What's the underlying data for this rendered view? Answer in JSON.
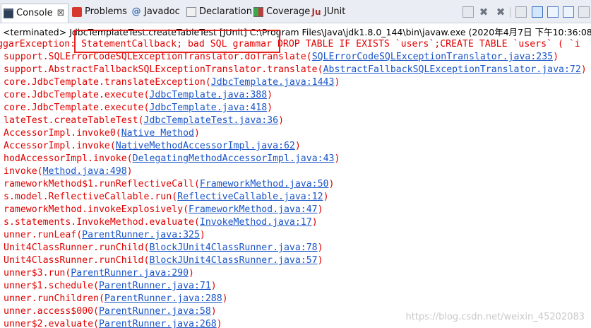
{
  "tabs": [
    {
      "label": "Console",
      "close": "⊠",
      "icon": "console-icon"
    },
    {
      "label": "Problems",
      "icon": "problems-icon"
    },
    {
      "label": "Javadoc",
      "icon": "javadoc-icon"
    },
    {
      "label": "Declaration",
      "icon": "declaration-icon"
    },
    {
      "label": "Coverage",
      "icon": "coverage-icon"
    },
    {
      "label": "JUnit",
      "icon": "junit-icon"
    }
  ],
  "status": "<terminated> JdbcTemplateTest.createTableTest [JUnit] C:\\Program Files\\Java\\jdk1.8.0_144\\bin\\javaw.exe (2020年4月7日 下午10:36:08)",
  "lines": [
    {
      "pre": "ggarException: ",
      "mid": "StatementCallback; bad SQL grammar",
      "post": "  DROP TABLE IF EXISTS `users`;CREATE TABLE `users` (  `i"
    },
    {
      "pre": "support.SQLErrorCodeSQLExceptionTranslator.doTranslate(",
      "link": "SQLErrorCodeSQLExceptionTranslator.java:235",
      "post": ")"
    },
    {
      "pre": "support.AbstractFallbackSQLExceptionTranslator.translate(",
      "link": "AbstractFallbackSQLExceptionTranslator.java:72",
      "post": ")"
    },
    {
      "pre": "core.JdbcTemplate.translateException(",
      "link": "JdbcTemplate.java:1443",
      "post": ")"
    },
    {
      "pre": "core.JdbcTemplate.execute(",
      "link": "JdbcTemplate.java:388",
      "post": ")"
    },
    {
      "pre": "core.JdbcTemplate.execute(",
      "link": "JdbcTemplate.java:418",
      "post": ")"
    },
    {
      "pre": "lateTest.createTableTest(",
      "link": "JdbcTemplateTest.java:36",
      "post": ")"
    },
    {
      "pre": "AccessorImpl.invoke0(",
      "link": "Native Method",
      "post": ")"
    },
    {
      "pre": "AccessorImpl.invoke(",
      "link": "NativeMethodAccessorImpl.java:62",
      "post": ")"
    },
    {
      "pre": "hodAccessorImpl.invoke(",
      "link": "DelegatingMethodAccessorImpl.java:43",
      "post": ")"
    },
    {
      "pre": "invoke(",
      "link": "Method.java:498",
      "post": ")"
    },
    {
      "pre": "rameworkMethod$1.runReflectiveCall(",
      "link": "FrameworkMethod.java:50",
      "post": ")"
    },
    {
      "pre": "s.model.ReflectiveCallable.run(",
      "link": "ReflectiveCallable.java:12",
      "post": ")"
    },
    {
      "pre": "rameworkMethod.invokeExplosively(",
      "link": "FrameworkMethod.java:47",
      "post": ")"
    },
    {
      "pre": "s.statements.InvokeMethod.evaluate(",
      "link": "InvokeMethod.java:17",
      "post": ")"
    },
    {
      "pre": "unner.runLeaf(",
      "link": "ParentRunner.java:325",
      "post": ")"
    },
    {
      "pre": "Unit4ClassRunner.runChild(",
      "link": "BlockJUnit4ClassRunner.java:78",
      "post": ")"
    },
    {
      "pre": "Unit4ClassRunner.runChild(",
      "link": "BlockJUnit4ClassRunner.java:57",
      "post": ")"
    },
    {
      "pre": "unner$3.run(",
      "link": "ParentRunner.java:290",
      "post": ")"
    },
    {
      "pre": "unner$1.schedule(",
      "link": "ParentRunner.java:71",
      "post": ")"
    },
    {
      "pre": "unner.runChildren(",
      "link": "ParentRunner.java:288",
      "post": ")"
    },
    {
      "pre": "unner.access$000(",
      "link": "ParentRunner.java:58",
      "post": ")"
    },
    {
      "pre": "unner$2.evaluate(",
      "link": "ParentRunner.java:268",
      "post": ")"
    }
  ],
  "watermark": "https://blog.csdn.net/weixin_45202083",
  "colors": {
    "error": "#e00000",
    "link": "#1a55c8",
    "highlight": "#e3261f"
  }
}
